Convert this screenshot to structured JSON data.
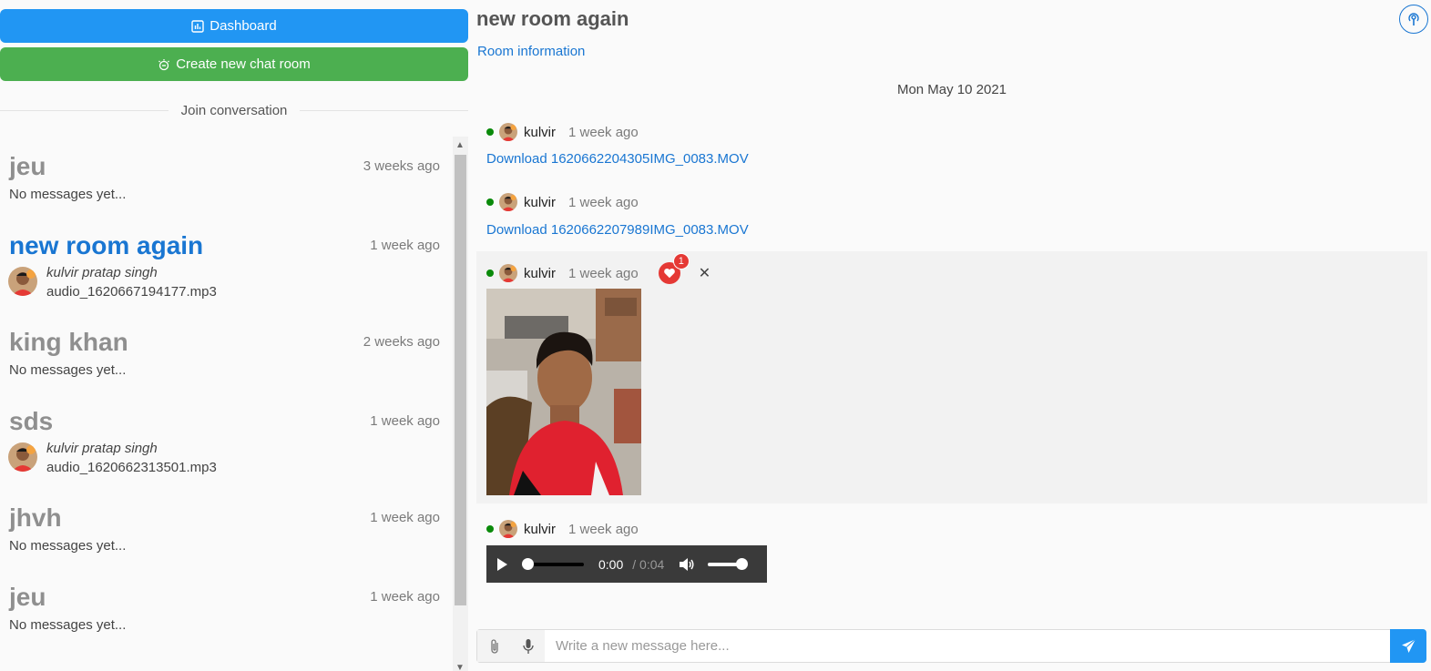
{
  "sidebar": {
    "dashboard_label": "Dashboard",
    "create_room_label": "Create new chat room",
    "join_label": "Join conversation",
    "rooms": [
      {
        "title": "jeu",
        "time": "3 weeks ago",
        "sub": "No messages yet..."
      },
      {
        "title": "new room again",
        "time": "1 week ago",
        "sender": "kulvir pratap singh",
        "file": "audio_1620667194177.mp3"
      },
      {
        "title": "king khan",
        "time": "2 weeks ago",
        "sub": "No messages yet..."
      },
      {
        "title": "sds",
        "time": "1 week ago",
        "sender": "kulvir pratap singh",
        "file": "audio_1620662313501.mp3"
      },
      {
        "title": "jhvh",
        "time": "1 week ago",
        "sub": "No messages yet..."
      },
      {
        "title": "jeu",
        "time": "1 week ago",
        "sub": "No messages yet..."
      }
    ]
  },
  "main": {
    "title": "new room again",
    "room_info_label": "Room information",
    "date_separator": "Mon May 10 2021",
    "messages": [
      {
        "user": "kulvir",
        "time": "1 week ago",
        "download": "Download 1620662204305IMG_0083.MOV"
      },
      {
        "user": "kulvir",
        "time": "1 week ago",
        "download": "Download 1620662207989IMG_0083.MOV"
      },
      {
        "user": "kulvir",
        "time": "1 week ago",
        "reaction_count": "1"
      },
      {
        "user": "kulvir",
        "time": "1 week ago",
        "audio_current": "0:00",
        "audio_duration": "/ 0:04"
      }
    ]
  },
  "composer": {
    "placeholder": "Write a new message here..."
  },
  "colors": {
    "primary": "#2196f3",
    "success": "#4caf50",
    "link": "#1976d2",
    "online": "#0a8a0a",
    "reaction": "#e53935"
  }
}
